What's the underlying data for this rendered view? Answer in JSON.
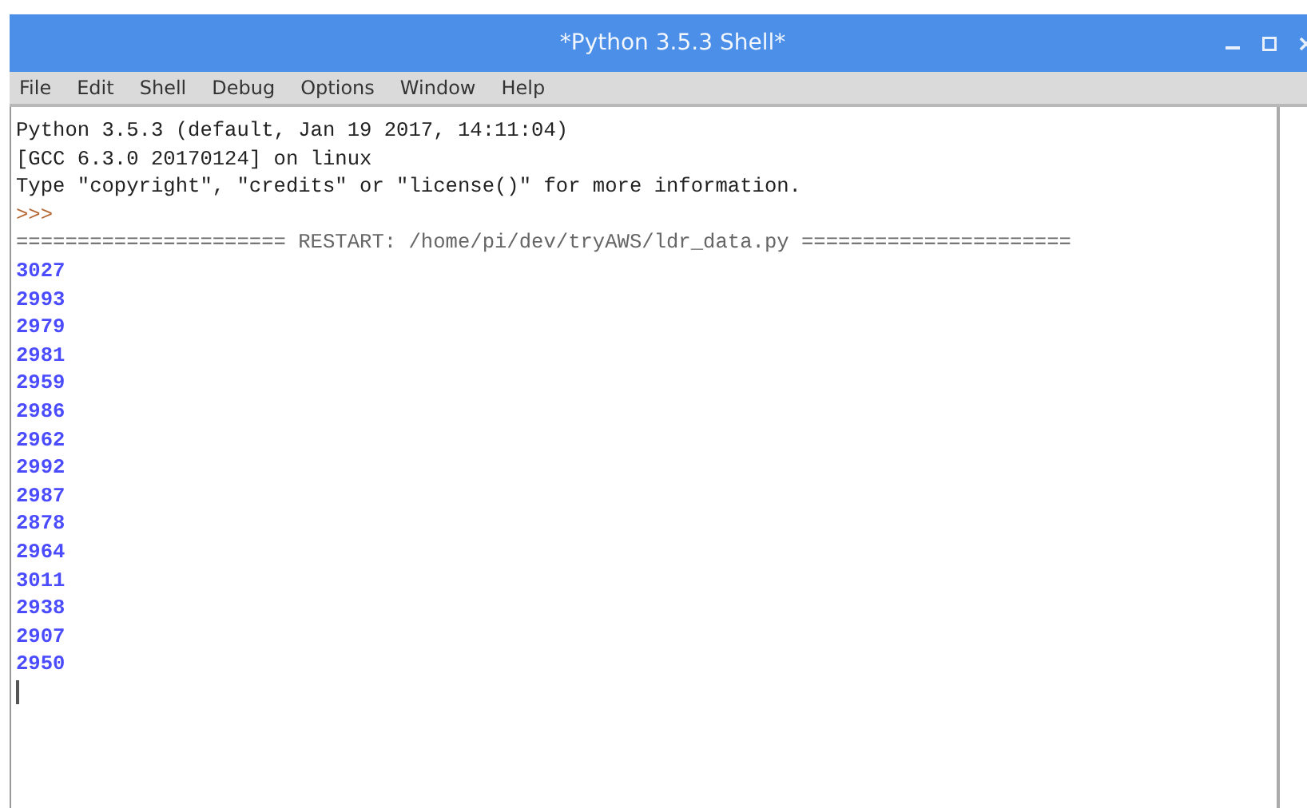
{
  "window": {
    "title": "*Python 3.5.3 Shell*"
  },
  "menu": [
    "File",
    "Edit",
    "Shell",
    "Debug",
    "Options",
    "Window",
    "Help"
  ],
  "lines": [
    {
      "kind": "banner",
      "text": "Python 3.5.3 (default, Jan 19 2017, 14:11:04)"
    },
    {
      "kind": "banner",
      "text": "[GCC 6.3.0 20170124] on linux"
    },
    {
      "kind": "banner",
      "text": "Type \"copyright\", \"credits\" or \"license()\" for more information."
    },
    {
      "kind": "prompt",
      "text": ">>>"
    },
    {
      "kind": "restart",
      "text": "====================== RESTART: /home/pi/dev/tryAWS/ldr_data.py ======================"
    },
    {
      "kind": "output",
      "text": "3027"
    },
    {
      "kind": "output",
      "text": "2993"
    },
    {
      "kind": "output",
      "text": "2979"
    },
    {
      "kind": "output",
      "text": "2981"
    },
    {
      "kind": "output",
      "text": "2959"
    },
    {
      "kind": "output",
      "text": "2986"
    },
    {
      "kind": "output",
      "text": "2962"
    },
    {
      "kind": "output",
      "text": "2992"
    },
    {
      "kind": "output",
      "text": "2987"
    },
    {
      "kind": "output",
      "text": "2878"
    },
    {
      "kind": "output",
      "text": "2964"
    },
    {
      "kind": "output",
      "text": "3011"
    },
    {
      "kind": "output",
      "text": "2938"
    },
    {
      "kind": "output",
      "text": "2907"
    },
    {
      "kind": "output",
      "text": "2950"
    }
  ]
}
